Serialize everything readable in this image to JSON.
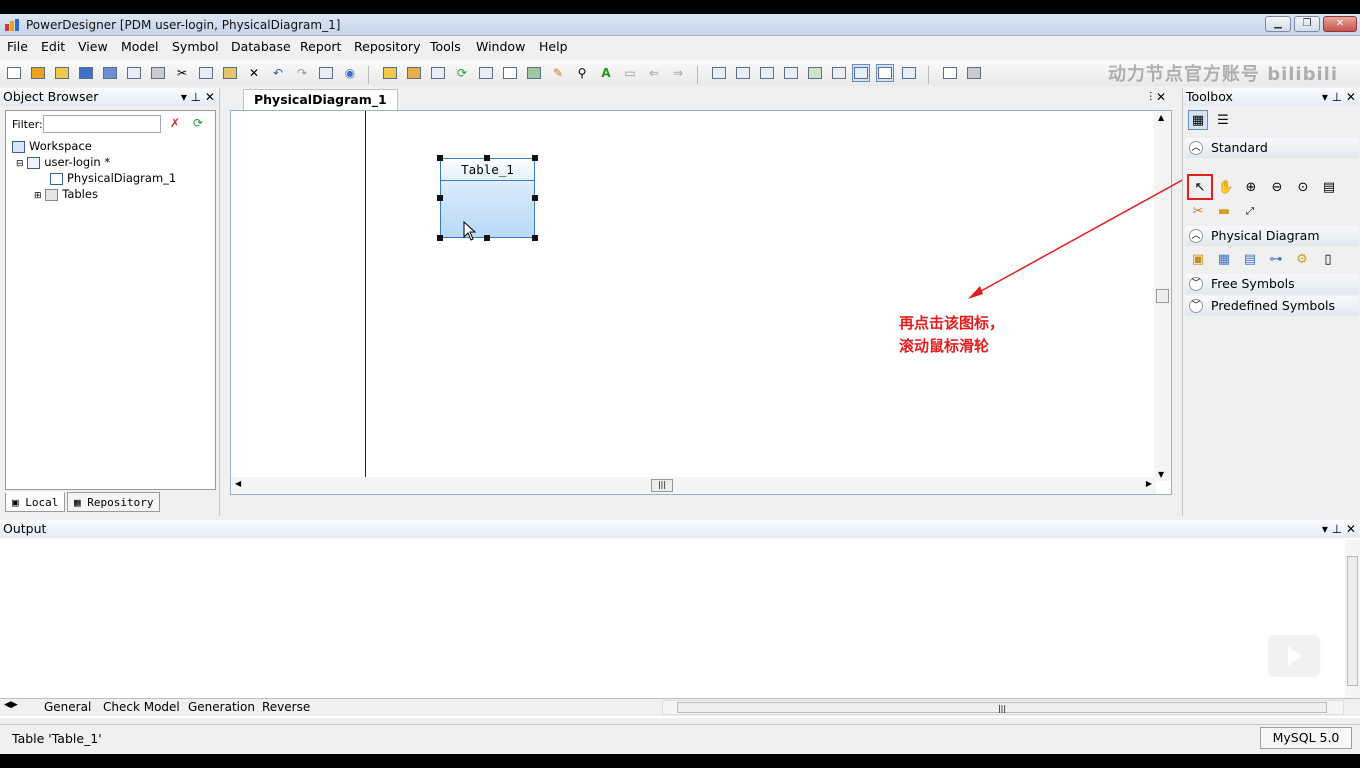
{
  "window": {
    "title": "PowerDesigner [PDM user-login, PhysicalDiagram_1]",
    "buttons": [
      "minimize",
      "restore",
      "close"
    ]
  },
  "menu": [
    "File",
    "Edit",
    "View",
    "Model",
    "Symbol",
    "Database",
    "Report",
    "Repository",
    "Tools",
    "Window",
    "Help"
  ],
  "watermark": "动力节点官方账号 bilibili",
  "object_browser": {
    "title": "Object Browser",
    "filter_label": "Filter:",
    "filter_value": "",
    "tree": {
      "workspace": "Workspace",
      "model": "user-login *",
      "diagram": "PhysicalDiagram_1",
      "tables": "Tables"
    },
    "tabs": [
      "Local",
      "Repository"
    ]
  },
  "diagram": {
    "tab": "PhysicalDiagram_1",
    "table_name": "Table_1"
  },
  "annotation": {
    "line1": "再点击该图标，",
    "line2": "滚动鼠标滑轮",
    "color": "#e41e1e"
  },
  "toolbox": {
    "title": "Toolbox",
    "sections": {
      "standard": "Standard",
      "physical": "Physical Diagram",
      "free": "Free Symbols",
      "predefined": "Predefined Symbols"
    }
  },
  "output": {
    "title": "Output",
    "tabs": [
      "General",
      "Check Model",
      "Generation",
      "Reverse"
    ]
  },
  "status": {
    "text": "Table 'Table_1'",
    "dbms": "MySQL 5.0"
  }
}
